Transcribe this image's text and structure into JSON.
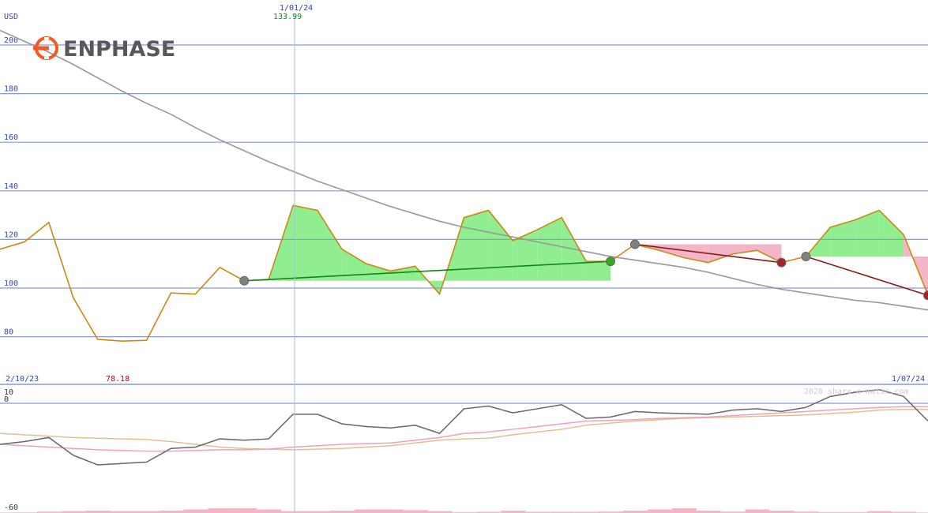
{
  "header": {
    "currency": "USD",
    "brand": "ENPHASE",
    "cursor_date": "1/01/24",
    "cursor_value": "133.99",
    "start_date": "2/10/23",
    "end_date": "1/07/24",
    "low_value": "78.18",
    "watermark": "2026 share-o-matic.com"
  },
  "colors": {
    "grid": "#8899dd",
    "price": "#cc8811",
    "ma_long": "#999999",
    "gain_fill": "#90ee90",
    "loss_fill": "#f4b6c6",
    "trend_up": "#118811",
    "trend_down": "#8b1a1a",
    "brand_orange": "#f15a24",
    "osc_main": "#666666",
    "osc_pink": "#f2a0b8",
    "osc_tan": "#e0c090",
    "volume": "#f4b6c6"
  },
  "chart_data": [
    {
      "type": "line",
      "title": "ENPHASE",
      "ylabel": "USD",
      "ylim": [
        63,
        213
      ],
      "yticks": [
        80,
        100,
        120,
        140,
        160,
        180,
        200
      ],
      "xlim": [
        0,
        38
      ],
      "x_labels": [
        "2/10/23",
        "1/07/24"
      ],
      "grid": true,
      "series": [
        {
          "values": [
            116,
            119,
            127,
            96,
            78.9,
            78.18,
            78.5,
            98,
            97.5,
            108.5,
            103,
            103.5,
            133.99,
            132,
            116,
            110,
            107,
            109,
            97.5,
            129,
            132,
            119.5,
            124,
            129,
            111,
            111,
            118,
            115.5,
            112.5,
            110.5,
            114,
            115.5,
            110.5,
            113,
            125,
            128,
            132,
            122,
            97
          ]
        },
        {
          "values": [
            206,
            201.5,
            197,
            192,
            186.5,
            181,
            176,
            171.5,
            166,
            161,
            156.5,
            152,
            148,
            144,
            140.5,
            137,
            133.5,
            130.5,
            127.5,
            125,
            123,
            121,
            119,
            117,
            115,
            113,
            111.5,
            110,
            108.5,
            106.5,
            104,
            101.5,
            99.5,
            98,
            96.5,
            95,
            94,
            92.5,
            91
          ]
        }
      ],
      "segments": [
        {
          "direction": "up",
          "start_x": 10,
          "start_y": 103,
          "end_x": 25,
          "end_y": 111
        },
        {
          "direction": "down",
          "start_x": 26,
          "start_y": 118,
          "end_x": 32,
          "end_y": 110.5
        },
        {
          "direction": "down",
          "start_x": 33,
          "start_y": 113,
          "end_x": 38,
          "end_y": 97
        }
      ],
      "cursor_x": 12
    },
    {
      "type": "line",
      "ylim": [
        -60,
        10
      ],
      "yticks": [
        10,
        0,
        -60
      ],
      "series": [
        {
          "values": [
            -30,
            -28,
            -25,
            -38,
            -45,
            -44,
            -43,
            -33,
            -32,
            -26,
            -27,
            -26,
            -8,
            -8,
            -15,
            -17,
            -18,
            -16,
            -22,
            -4,
            -2,
            -7,
            -4,
            -1,
            -11,
            -10,
            -6,
            -7,
            -7.5,
            -8,
            -5,
            -4,
            -6,
            -3,
            5,
            8,
            10,
            5,
            -13
          ]
        },
        {
          "values": [
            -30,
            -31,
            -32,
            -33,
            -34,
            -34.5,
            -35,
            -35,
            -34.5,
            -34,
            -34,
            -33.5,
            -32,
            -31,
            -30,
            -29.5,
            -29,
            -27,
            -25,
            -22,
            -21,
            -19,
            -17,
            -15,
            -13,
            -12.5,
            -12,
            -11,
            -10.5,
            -10,
            -9,
            -8,
            -7,
            -6,
            -5,
            -4,
            -3,
            -2.5,
            -2.5
          ]
        },
        {
          "values": [
            -22,
            -23,
            -24,
            -25,
            -25.5,
            -26,
            -26.5,
            -28,
            -30,
            -32,
            -33,
            -33.5,
            -34,
            -33.5,
            -33,
            -32,
            -31,
            -29,
            -27,
            -26,
            -25.5,
            -23,
            -21,
            -19,
            -16,
            -14.5,
            -13,
            -12,
            -11,
            -10.5,
            -10,
            -9.5,
            -9,
            -8.5,
            -7.5,
            -6.5,
            -5,
            -4.5,
            -4.5
          ]
        }
      ],
      "volume": [
        0.2,
        0.3,
        0.6,
        0.8,
        1,
        0.8,
        0.8,
        1,
        1.5,
        2,
        2,
        1.5,
        0.8,
        0.8,
        1,
        1.5,
        1.5,
        1.2,
        0.8,
        0.4,
        0.5,
        1,
        0.5,
        0.5,
        0.5,
        0.6,
        1,
        1.5,
        2,
        1,
        0.6,
        1.5,
        1,
        0.6,
        0.4,
        0.4,
        0.8,
        0.5,
        0.2
      ]
    }
  ]
}
